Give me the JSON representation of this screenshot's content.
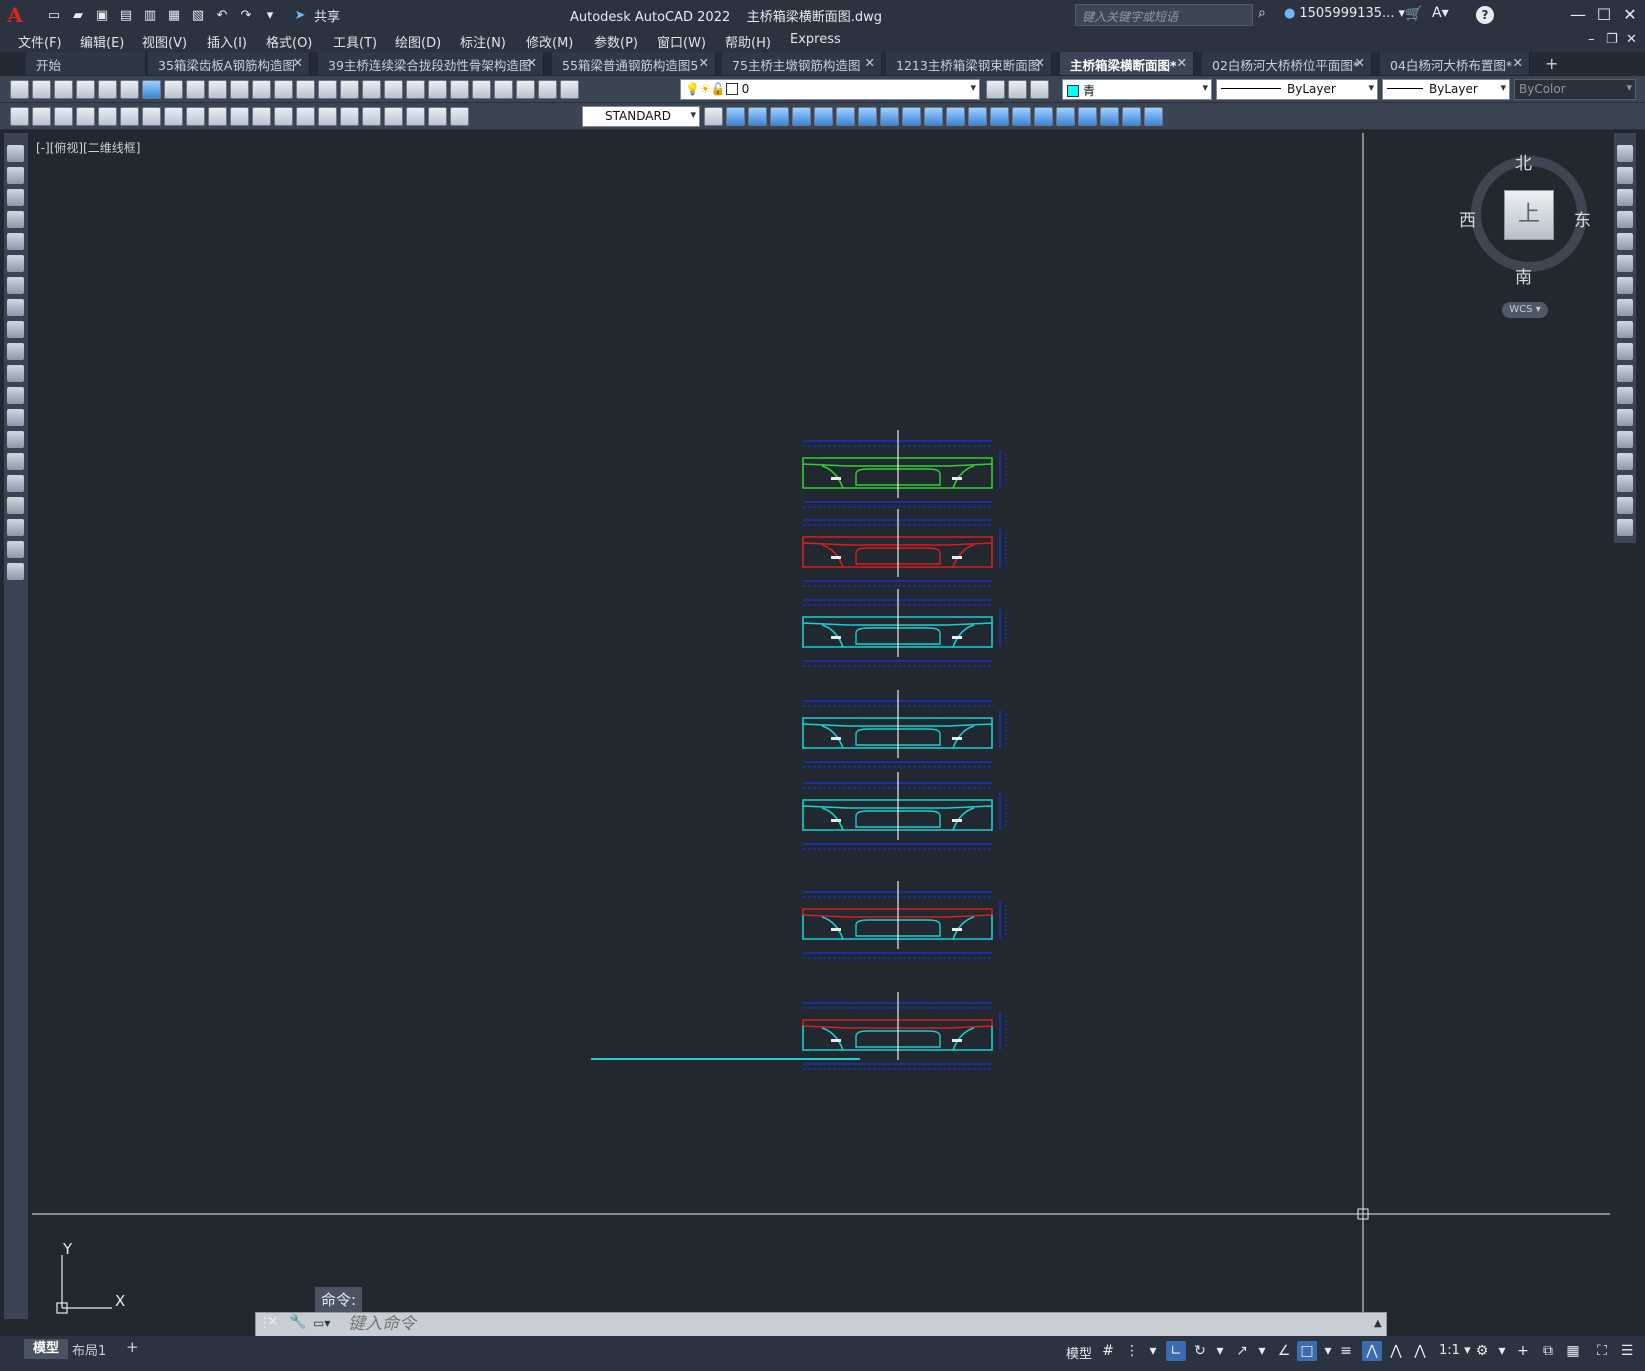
{
  "app": {
    "logo": "A",
    "title": "Autodesk AutoCAD 2022    主桥箱梁横断面图.dwg",
    "share_label": "共享",
    "search_placeholder": "键入关键字或短语",
    "user": "1505999135...",
    "accent": "#e2231a"
  },
  "menu": [
    "文件(F)",
    "编辑(E)",
    "视图(V)",
    "插入(I)",
    "格式(O)",
    "工具(T)",
    "绘图(D)",
    "标注(N)",
    "修改(M)",
    "参数(P)",
    "窗口(W)",
    "帮助(H)",
    "Express"
  ],
  "tabs": [
    {
      "label": "开始",
      "active": false,
      "closable": false
    },
    {
      "label": "35箱梁齿板A钢筋构造图",
      "active": false,
      "closable": true
    },
    {
      "label": "39主桥连续梁合拢段劲性骨架构造图",
      "active": false,
      "closable": true
    },
    {
      "label": "55箱梁普通钢筋构造图5",
      "active": false,
      "closable": true
    },
    {
      "label": "75主桥主墩钢筋构造图",
      "active": false,
      "closable": true
    },
    {
      "label": "1213主桥箱梁钢束断面图",
      "active": false,
      "closable": true
    },
    {
      "label": "主桥箱梁横断面图*",
      "active": true,
      "closable": true
    },
    {
      "label": "02白杨河大桥桥位平面图*",
      "active": false,
      "closable": true
    },
    {
      "label": "04白杨河大桥布置图*",
      "active": false,
      "closable": true
    }
  ],
  "toolbar": {
    "layer": "0",
    "color": "青",
    "color_hex": "#00ffff",
    "linetype": "ByLayer",
    "lineweight": "ByLayer",
    "plotstyle": "ByColor",
    "textstyle": "STANDARD"
  },
  "viewport_label": "[-][俯视][二维线框]",
  "viewcube": {
    "north": "北",
    "south": "南",
    "east": "东",
    "west": "西",
    "face": "上",
    "wcs": "WCS"
  },
  "ucs": {
    "x": "X",
    "y": "Y"
  },
  "command": {
    "history": "命令:",
    "placeholder": "键入命令"
  },
  "status": {
    "model_tab": "模型",
    "layout_tab": "布局1",
    "model_label": "模型",
    "scale": "1:1"
  },
  "sections": [
    {
      "top": "green",
      "webs": "green"
    },
    {
      "top": "red",
      "webs": "red"
    },
    {
      "top": "cyan",
      "webs": "cyan"
    },
    {
      "top": "cyan",
      "webs": "cyan"
    },
    {
      "top": "cyan",
      "webs": "cyan"
    },
    {
      "top": "red",
      "webs": "mixed"
    },
    {
      "top": "red",
      "webs": "cyan"
    }
  ]
}
